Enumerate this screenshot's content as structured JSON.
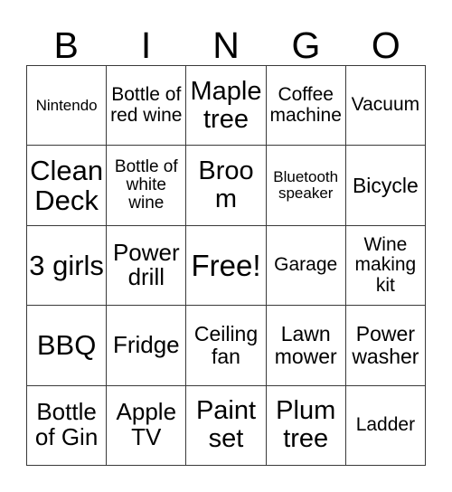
{
  "card": {
    "type": "bingo-card",
    "grid_size": 5,
    "header": {
      "letters": [
        "B",
        "I",
        "N",
        "G",
        "O"
      ]
    },
    "rows": [
      [
        {
          "label": "Nintendo",
          "size": "fs-xs"
        },
        {
          "label": "Bottle of red wine",
          "size": "fs-m"
        },
        {
          "label": "Maple tree",
          "size": "fs-xl"
        },
        {
          "label": "Coffee machine",
          "size": "fs-m"
        },
        {
          "label": "Vacuum",
          "size": "fs-m"
        }
      ],
      [
        {
          "label": "Clean Deck",
          "size": "fs-xxl"
        },
        {
          "label": "Bottle of white wine",
          "size": "fs-s"
        },
        {
          "label": "Broom",
          "size": "fs-xl"
        },
        {
          "label": "Bluetooth speaker",
          "size": "fs-xs"
        },
        {
          "label": "Bicycle",
          "size": "fs-ml"
        }
      ],
      [
        {
          "label": "3 girls",
          "size": "fs-xxl"
        },
        {
          "label": "Power drill",
          "size": "fs-l"
        },
        {
          "label": "Free!",
          "size": "fs-free"
        },
        {
          "label": "Garage",
          "size": "fs-m"
        },
        {
          "label": "Wine making kit",
          "size": "fs-m"
        }
      ],
      [
        {
          "label": "BBQ",
          "size": "fs-xxl"
        },
        {
          "label": "Fridge",
          "size": "fs-l"
        },
        {
          "label": "Ceiling fan",
          "size": "fs-ml"
        },
        {
          "label": "Lawn mower",
          "size": "fs-ml"
        },
        {
          "label": "Power washer",
          "size": "fs-ml"
        }
      ],
      [
        {
          "label": "Bottle of Gin",
          "size": "fs-l"
        },
        {
          "label": "Apple TV",
          "size": "fs-l"
        },
        {
          "label": "Paint set",
          "size": "fs-xl"
        },
        {
          "label": "Plum tree",
          "size": "fs-xl"
        },
        {
          "label": "Ladder",
          "size": "fs-m"
        }
      ]
    ]
  }
}
